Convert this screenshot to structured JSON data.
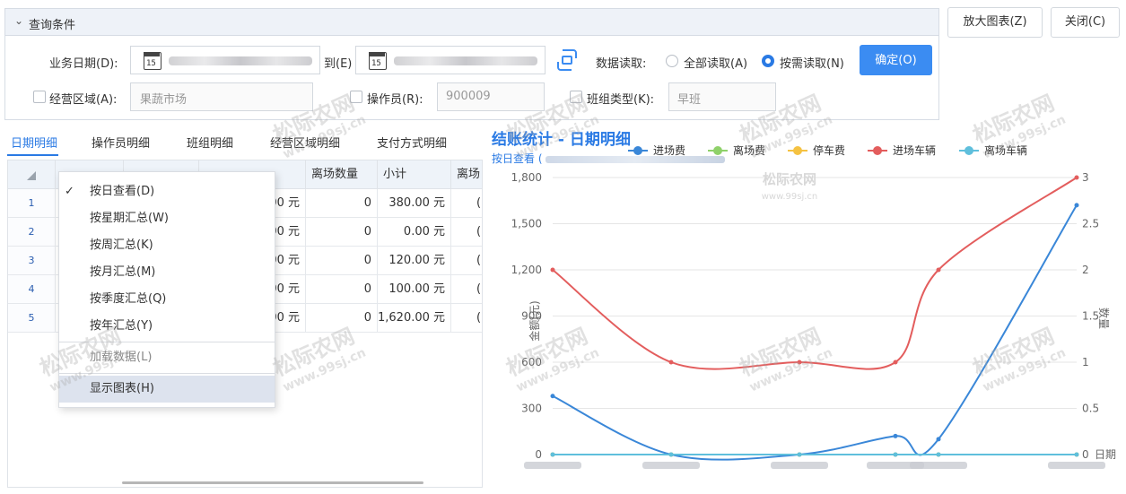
{
  "query": {
    "header": "查询条件",
    "biz_date_label": "业务日期(D):",
    "cal_day": "15",
    "to_label": "到(E)",
    "read_label": "数据读取:",
    "read_all": "全部读取(A)",
    "read_on_demand": "按需读取(N)",
    "read_selected": "按需读取(N)",
    "confirm": "确定(O)",
    "area_label": "经营区域(A):",
    "area_value": "果蔬市场",
    "operator_label": "操作员(R):",
    "operator_value": "900009",
    "shift_label": "班组类型(K):",
    "shift_value": "早班"
  },
  "top_buttons": {
    "zoom": "放大图表(Z)",
    "close": "关闭(C)"
  },
  "tabs": [
    "日期明细",
    "操作员明细",
    "班组明细",
    "经营区域明细",
    "支付方式明细"
  ],
  "active_tab": 0,
  "table": {
    "headers": [
      "离场数量",
      "小计",
      "离场"
    ],
    "rows": [
      {
        "n": "1",
        "amt": "00 元",
        "qty": "0",
        "sub": "380.00 元",
        "tail": "("
      },
      {
        "n": "2",
        "amt": "00 元",
        "qty": "0",
        "sub": "0.00 元",
        "tail": "("
      },
      {
        "n": "3",
        "amt": "00 元",
        "qty": "0",
        "sub": "120.00 元",
        "tail": "("
      },
      {
        "n": "4",
        "amt": "00 元",
        "qty": "0",
        "sub": "100.00 元",
        "tail": "("
      },
      {
        "n": "5",
        "amt": "00 元",
        "qty": "0",
        "sub": "1,620.00 元",
        "tail": "("
      }
    ]
  },
  "context_menu": {
    "items": [
      "按日查看(D)",
      "按星期汇总(W)",
      "按周汇总(K)",
      "按月汇总(M)",
      "按季度汇总(Q)",
      "按年汇总(Y)",
      "加载数据(L)",
      "显示图表(H)"
    ],
    "checked": "按日查看(D)",
    "disabled": "加载数据(L)",
    "highlighted": "显示图表(H)"
  },
  "watermark": {
    "cn": "松际农网",
    "url": "www.99sj.cn",
    "logo_cn": "松际农网",
    "logo_url": "www.99sj.cn"
  },
  "chart_data": {
    "type": "line",
    "title": "结账统计 - 日期明细",
    "subtitle": "按日查看 (",
    "legend": [
      "进场费",
      "离场费",
      "停车费",
      "进场车辆",
      "离场车辆"
    ],
    "legend_placement": "top-right",
    "ylabel_left": "金额(元)",
    "ylabel_right": "数量",
    "xlabel": "日期",
    "y_left_ticks": [
      "0",
      "300",
      "600",
      "900",
      "1,200",
      "1,500",
      "1,800"
    ],
    "y_right_ticks": [
      "0",
      "0.5",
      "1",
      "1.5",
      "2",
      "2.5",
      "3"
    ],
    "ylim_left": [
      0,
      1800
    ],
    "ylim_right": [
      0,
      3
    ],
    "x_count": 6,
    "colors": {
      "进场费": "#3a87d8",
      "离场费": "#8fd16a",
      "停车费": "#f5c242",
      "进场车辆": "#e35d5d",
      "离场车辆": "#5fbfdc"
    },
    "series": [
      {
        "name": "进场费",
        "axis": "left",
        "values": [
          380,
          0,
          0,
          120,
          100,
          1620
        ]
      },
      {
        "name": "离场费",
        "axis": "left",
        "values": [
          0,
          0,
          0,
          0,
          0,
          0
        ]
      },
      {
        "name": "停车费",
        "axis": "left",
        "values": [
          0,
          0,
          0,
          0,
          0,
          0
        ]
      },
      {
        "name": "进场车辆",
        "axis": "right",
        "values": [
          2,
          1,
          1,
          1,
          2,
          3
        ]
      },
      {
        "name": "离场车辆",
        "axis": "right",
        "values": [
          0,
          0,
          0,
          0,
          0,
          0
        ]
      }
    ],
    "grid": true
  }
}
